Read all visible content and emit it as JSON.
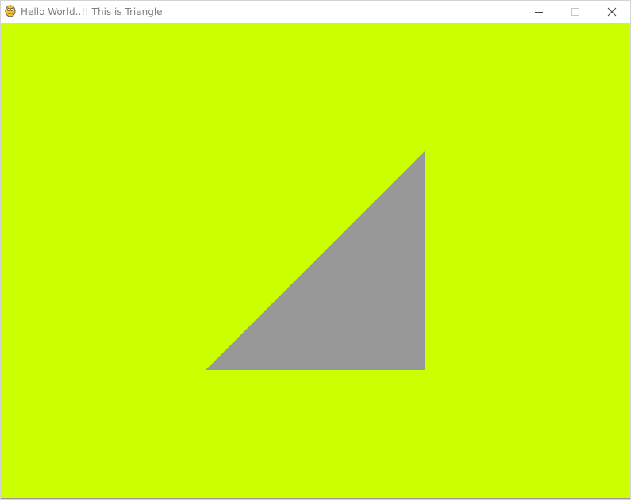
{
  "window": {
    "title": "Hello World..!! This is Triangle",
    "app_icon": "pygame-snake-icon",
    "controls": {
      "minimize_icon": "minimize-icon",
      "maximize_icon": "maximize-icon",
      "close_icon": "close-icon"
    }
  },
  "canvas": {
    "background_color": "#ccff00",
    "triangle": {
      "fill_color": "#989898"
    }
  }
}
